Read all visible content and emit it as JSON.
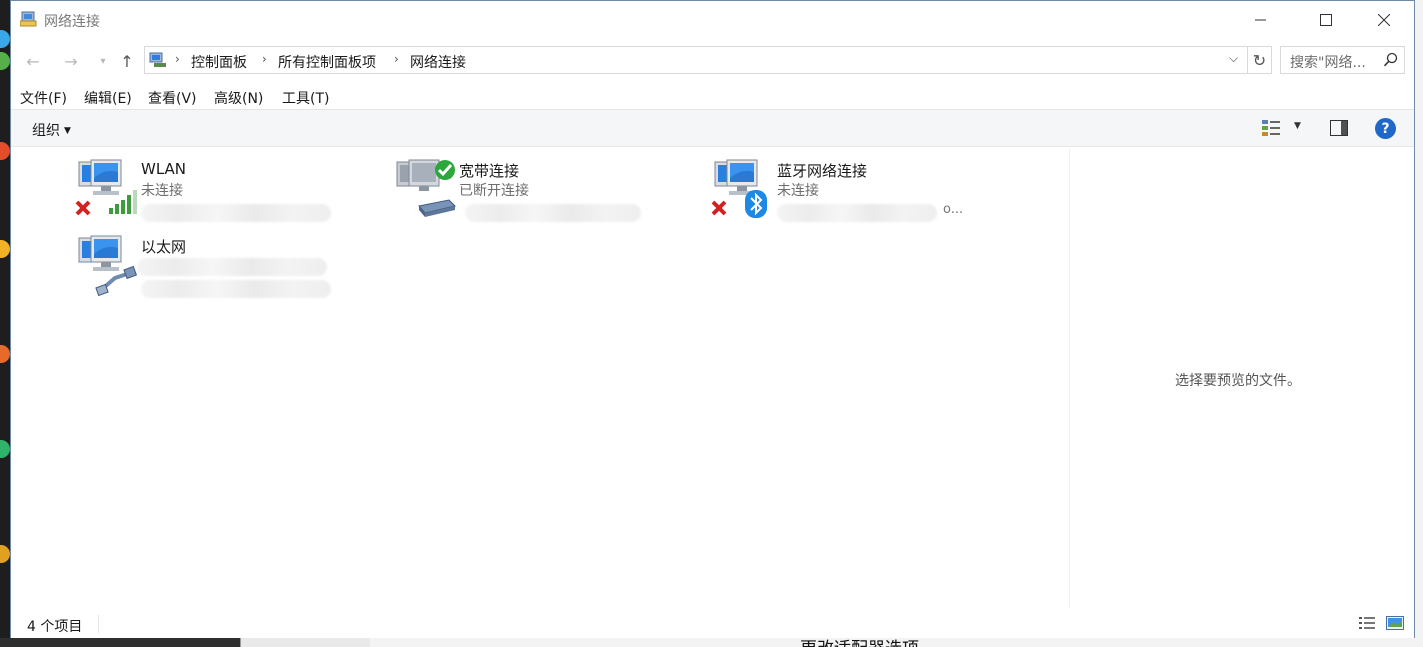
{
  "window": {
    "title": "网络连接",
    "min_icon": "minimize-icon",
    "max_icon": "maximize-icon",
    "close_icon": "close-icon"
  },
  "address": {
    "crumbs": [
      "控制面板",
      "所有控制面板项",
      "网络连接"
    ],
    "search_placeholder": "搜索\"网络..."
  },
  "menu": [
    "文件(F)",
    "编辑(E)",
    "查看(V)",
    "高级(N)",
    "工具(T)"
  ],
  "toolbar": {
    "organize_label": "组织"
  },
  "connections": [
    {
      "name": "WLAN",
      "status": "未连接",
      "adapter_icon": "wifi-signal-icon",
      "state_icon": "disconnected-x-icon",
      "detail": ""
    },
    {
      "name": "宽带连接",
      "status": "已断开连接",
      "adapter_icon": "modem-icon",
      "state_icon": "connected-check-icon",
      "detail": ""
    },
    {
      "name": "蓝牙网络连接",
      "status": "未连接",
      "adapter_icon": "bluetooth-icon",
      "state_icon": "disconnected-x-icon",
      "detail": "o..."
    },
    {
      "name": "以太网",
      "status": "",
      "adapter_icon": "ethernet-cable-icon",
      "state_icon": "",
      "detail": ""
    }
  ],
  "preview": {
    "placeholder": "选择要预览的文件。"
  },
  "statusbar": {
    "item_count": "4 个项目"
  },
  "background": {
    "cut_text": "更改适配器选项"
  },
  "colors": {
    "accent": "#1f67c8",
    "error_red": "#d42020",
    "ok_green": "#2da63b",
    "bluetooth": "#1e88e5"
  }
}
